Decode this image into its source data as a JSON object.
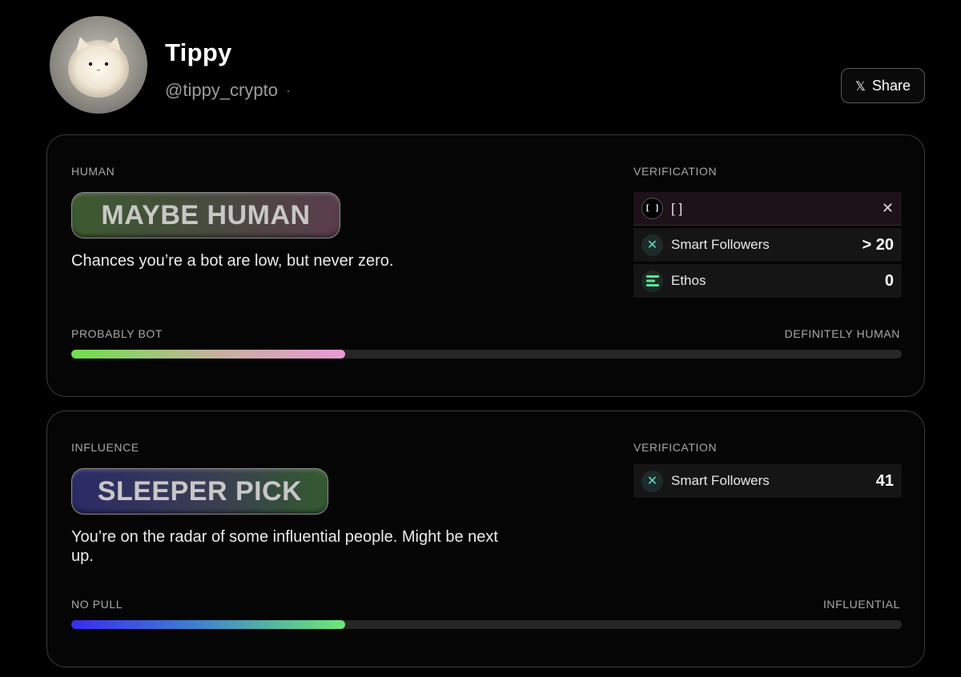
{
  "profile": {
    "name": "Tippy",
    "handle": "@tippy_crypto",
    "separator": "·",
    "share_label": "Share",
    "share_icon": "𝕏"
  },
  "human": {
    "section_label": "HUMAN",
    "verdict": "MAYBE HUMAN",
    "description": "Chances you’re a bot are low, but never zero.",
    "verification_label": "VERIFICATION",
    "verification": [
      {
        "icon": "bracket-icon",
        "icon_glyph": "[ ]",
        "label": "[ ]",
        "value": "",
        "closable": true
      },
      {
        "icon": "smart-followers-icon",
        "icon_glyph": "✕",
        "label": "Smart Followers",
        "value": "> 20"
      },
      {
        "icon": "ethos-icon",
        "icon_glyph": "≡",
        "label": "Ethos",
        "value": "0"
      }
    ],
    "close_glyph": "✕",
    "scale_left": "PROBABLY BOT",
    "scale_right": "DEFINITELY HUMAN",
    "scale_fraction": 0.33
  },
  "influence": {
    "section_label": "INFLUENCE",
    "verdict": "SLEEPER PICK",
    "description": "You’re on the radar of some influential people. Might be next up.",
    "verification_label": "VERIFICATION",
    "verification": [
      {
        "icon": "smart-followers-icon",
        "icon_glyph": "✕",
        "label": "Smart Followers",
        "value": "41"
      }
    ],
    "scale_left": "NO PULL",
    "scale_right": "INFLUENTIAL",
    "scale_fraction": 0.33
  }
}
